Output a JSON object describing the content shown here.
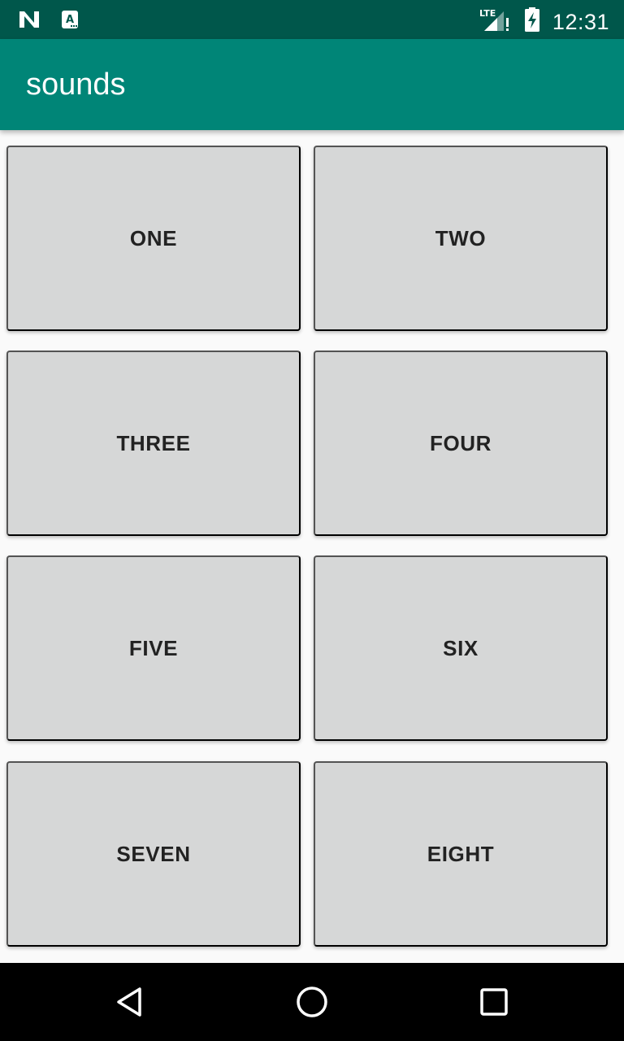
{
  "status_bar": {
    "time": "12:31",
    "network": "LTE",
    "icons": [
      "n-notification-icon",
      "a-notification-icon",
      "signal-icon",
      "battery-charging-icon"
    ]
  },
  "app_bar": {
    "title": "sounds"
  },
  "buttons": [
    {
      "label": "ONE"
    },
    {
      "label": "TWO"
    },
    {
      "label": "THREE"
    },
    {
      "label": "FOUR"
    },
    {
      "label": "FIVE"
    },
    {
      "label": "SIX"
    },
    {
      "label": "SEVEN"
    },
    {
      "label": "EIGHT"
    }
  ],
  "nav_bar": {
    "icons": [
      "back-icon",
      "home-icon",
      "recents-icon"
    ]
  },
  "colors": {
    "status_bar": "#00574b",
    "app_bar": "#008577",
    "button": "#d6d7d7",
    "background": "#fafafa"
  }
}
